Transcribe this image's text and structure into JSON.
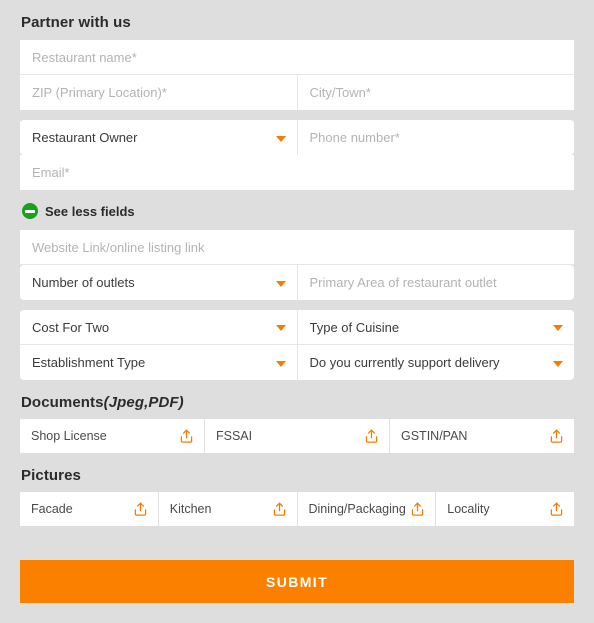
{
  "theme": {
    "background": "#dedede",
    "field_background": "#ffffff",
    "accent_orange": "#fb8000",
    "caret_orange": "#f57c00",
    "toggle_green": "#1aa01a",
    "placeholder_color": "#b3b3b3",
    "value_color": "#3b3b3b",
    "heading_color": "#2b2b2b"
  },
  "form": {
    "title": "Partner with us",
    "fields": {
      "restaurant_name": "Restaurant name*",
      "zip": "ZIP (Primary Location)*",
      "city": "City/Town*",
      "role": "Restaurant Owner",
      "phone": "Phone number*",
      "email": "Email*",
      "website": "Website Link/online listing link",
      "outlets": "Number of outlets",
      "primary_area": "Primary Area of restaurant outlet",
      "cost_for_two": "Cost For Two",
      "cuisine": "Type of Cuisine",
      "establishment": "Establishment Type",
      "delivery": "Do you currently support delivery"
    },
    "toggle": {
      "label": "See less fields",
      "icon": "circle-minus-icon"
    }
  },
  "documents": {
    "heading": "Documents",
    "heading_suffix": "(Jpeg,PDF)",
    "items": [
      {
        "label": "Shop License",
        "icon": "upload-icon"
      },
      {
        "label": "FSSAI",
        "icon": "upload-icon"
      },
      {
        "label": "GSTIN/PAN",
        "icon": "upload-icon"
      }
    ]
  },
  "pictures": {
    "heading": "Pictures",
    "items": [
      {
        "label": "Facade",
        "icon": "upload-icon"
      },
      {
        "label": "Kitchen",
        "icon": "upload-icon"
      },
      {
        "label": "Dining/Packaging",
        "icon": "upload-icon"
      },
      {
        "label": "Locality",
        "icon": "upload-icon"
      }
    ]
  },
  "submit": {
    "label": "SUBMIT"
  }
}
